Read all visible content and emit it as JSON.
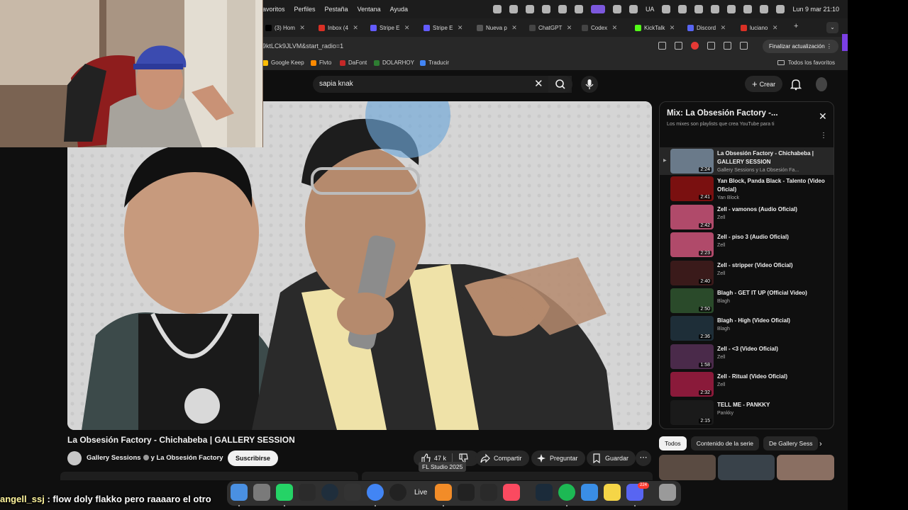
{
  "menubar": {
    "menus": [
      "avoritos",
      "Perfiles",
      "Pestaña",
      "Ventana",
      "Ayuda"
    ],
    "keyboard": "UA",
    "datetime": "Lun 9 mar  21:10"
  },
  "tabs": [
    {
      "label": "(3) Hom",
      "color": "#000000"
    },
    {
      "label": "Inbox (4",
      "color": "#d93025"
    },
    {
      "label": "Stripe E",
      "color": "#635bff"
    },
    {
      "label": "Stripe E",
      "color": "#635bff"
    },
    {
      "label": "Nueva p",
      "color": "#555555"
    },
    {
      "label": "ChatGPT",
      "color": "#444444"
    },
    {
      "label": "Codex",
      "color": "#444444"
    },
    {
      "label": "KickTalk",
      "color": "#53fc18"
    },
    {
      "label": "Discord",
      "color": "#5865f2"
    },
    {
      "label": "luciano",
      "color": "#d93025"
    }
  ],
  "address": {
    "url": "9ktLCk9JLVM&start_radio=1",
    "update_button": "Finalizar actualización"
  },
  "bookmarks": [
    {
      "label": "Google Keep",
      "color": "#fbbc04"
    },
    {
      "label": "Flvto",
      "color": "#ff8a00"
    },
    {
      "label": "DaFont",
      "color": "#c62828"
    },
    {
      "label": "DOLARHOY",
      "color": "#2e7d32"
    },
    {
      "label": "Traducir",
      "color": "#4285f4"
    }
  ],
  "bookmarks_right": "Todos los favoritos",
  "youtube": {
    "search_query": "sapia knak",
    "create_label": "Crear"
  },
  "video": {
    "title": "La Obsesión Factory - Chichabeba | GALLERY SESSION",
    "channel": "Gallery Sessions",
    "channel_joiner": "y La Obsesión Factory",
    "subscribe": "Suscribirse",
    "likes": "47 k",
    "share": "Compartir",
    "ask": "Preguntar",
    "save": "Guardar",
    "tooltip": "FL Studio 2025"
  },
  "playlist": {
    "title": "Mix: La Obsesión Factory -...",
    "subtitle": "Los mixes son playlists que crea YouTube para ti",
    "items": [
      {
        "title": "La Obsesión Factory - Chichabeba | GALLERY SESSION",
        "channel": "Gallery Sessions y La Obsesión Fa...",
        "duration": "2:24",
        "active": true,
        "tone": "#6a7a8a"
      },
      {
        "title": "Yan Block, Panda Black - Talento (Video Oficial)",
        "channel": "Yan Block",
        "duration": "2:41",
        "active": false,
        "tone": "#7a1010"
      },
      {
        "title": "Zell - vamonos (Audio Oficial)",
        "channel": "Zell",
        "duration": "2:42",
        "active": false,
        "tone": "#b04a6a"
      },
      {
        "title": "Zell - piso 3 (Audio Oficial)",
        "channel": "Zell",
        "duration": "2:23",
        "active": false,
        "tone": "#b04a6a"
      },
      {
        "title": "Zell - stripper (Video Oficial)",
        "channel": "Zell",
        "duration": "2:40",
        "active": false,
        "tone": "#3a1a1a"
      },
      {
        "title": "Blagh - GET IT UP (Official Video)",
        "channel": "Blagh",
        "duration": "2:50",
        "active": false,
        "tone": "#2a4a2a"
      },
      {
        "title": "Blagh - High (Video Oficial)",
        "channel": "Blagh",
        "duration": "2:36",
        "active": false,
        "tone": "#1e2e38"
      },
      {
        "title": "Zell - <3 (Video Oficial)",
        "channel": "Zell",
        "duration": "1:58",
        "active": false,
        "tone": "#4a2a4a"
      },
      {
        "title": "Zell - Ritual (Video Oficial)",
        "channel": "Zell",
        "duration": "2:32",
        "active": false,
        "tone": "#8a1a3a"
      },
      {
        "title": "TELL ME - PANKKY",
        "channel": "Pankky",
        "duration": "2:15",
        "active": false,
        "tone": "#1a1a1a"
      }
    ]
  },
  "chips": [
    "Todos",
    "Contenido de la serie",
    "De Gallery Sess"
  ],
  "dock": {
    "live_label": "Live",
    "discord_badge": "224"
  },
  "chat": {
    "user": "angell_ssj",
    "message": " : flow doly flakko pero raaaaro el otro"
  }
}
